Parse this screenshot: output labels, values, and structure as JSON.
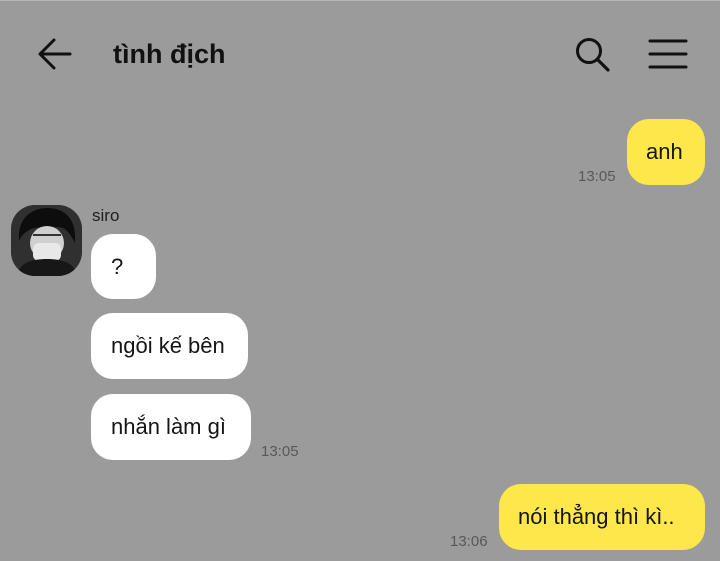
{
  "header": {
    "title": "tình địch",
    "back_icon": "arrow-left-icon",
    "search_icon": "search-icon",
    "menu_icon": "hamburger-menu-icon"
  },
  "messages": [
    {
      "direction": "outgoing",
      "text": "anh",
      "time": "13:05"
    },
    {
      "direction": "incoming",
      "sender": "siro",
      "text": "?"
    },
    {
      "direction": "incoming",
      "text": "ngồi kế bên"
    },
    {
      "direction": "incoming",
      "text": "nhắn làm gì",
      "time": "13:05"
    },
    {
      "direction": "outgoing",
      "text": "nói thẳng thì kì..",
      "time": "13:06"
    }
  ],
  "colors": {
    "background": "#9b9b9b",
    "outgoing_bubble": "#fde74a",
    "incoming_bubble": "#ffffff"
  }
}
